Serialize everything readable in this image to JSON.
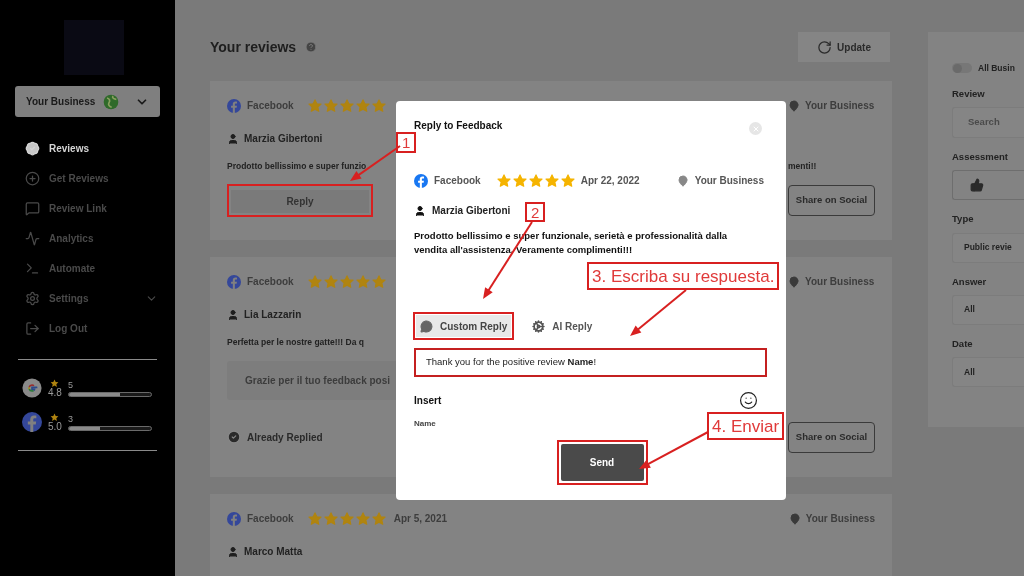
{
  "sidebar": {
    "business": "Your Business",
    "nav": [
      {
        "label": "Reviews",
        "selected": true,
        "has_submenu": false
      },
      {
        "label": "Get Reviews",
        "selected": false,
        "has_submenu": false
      },
      {
        "label": "Review Link",
        "selected": false,
        "has_submenu": false
      },
      {
        "label": "Analytics",
        "selected": false,
        "has_submenu": false
      },
      {
        "label": "Automate",
        "selected": false,
        "has_submenu": false
      },
      {
        "label": "Settings",
        "selected": false,
        "has_submenu": true
      },
      {
        "label": "Log Out",
        "selected": false,
        "has_submenu": false
      }
    ],
    "ratings": [
      {
        "kind": "google",
        "score": "4.8",
        "count": "5",
        "level": 0.62
      },
      {
        "kind": "facebook",
        "score": "5.0",
        "count": "3",
        "level": 0.38
      }
    ]
  },
  "header": {
    "title": "Your reviews",
    "update_button": "Update"
  },
  "reviews": [
    {
      "source": "Facebook",
      "stars": 5,
      "business": "Your Business",
      "author": "Marzia Gibertoni",
      "text_left": "Prodotto bellissimo e super funzio",
      "text_right": "menti!!",
      "kind": "pending",
      "action": "Reply",
      "share": "Share on Social"
    },
    {
      "source": "Facebook",
      "stars": 5,
      "business": "Your Business",
      "author": "Lia Lazzarin",
      "text_left": "Perfetta per le nostre gatte!!! Da q",
      "reply": "Grazie per il tuo feedback posi",
      "kind": "replied",
      "status": "Already Replied",
      "share": "Share on Social"
    },
    {
      "source": "Facebook",
      "stars": 5,
      "date": "Apr 5, 2021",
      "business": "Your Business",
      "author": "Marco Matta",
      "kind": "partial"
    }
  ],
  "filters": {
    "toggle": {
      "label": "All Busin",
      "on": false
    },
    "fields": [
      {
        "label": "Review",
        "kind": "search",
        "placeholder": "Search"
      },
      {
        "label": "Assessment",
        "kind": "thumbs"
      },
      {
        "label": "Type",
        "kind": "select",
        "value": "Public revie"
      },
      {
        "label": "Answer",
        "kind": "select",
        "value": "All"
      },
      {
        "label": "Date",
        "kind": "select",
        "value": "All"
      }
    ]
  },
  "modal": {
    "title": "Reply to Feedback",
    "source": "Facebook",
    "stars": 5,
    "date": "Apr 22, 2022",
    "business": "Your Business",
    "author": "Marzia Gibertoni",
    "text": "Prodotto bellissimo e super funzionale, serietà e professionalità dalla vendita all'assistenza. Veramente complimenti!!!",
    "tabs": [
      {
        "label": "Custom Reply",
        "selected": true
      },
      {
        "label": "AI Reply",
        "selected": false
      }
    ],
    "reply_value": "Thank you for the positive review **Name**!",
    "insert_label": "Insert",
    "insert_tags": [
      "Name"
    ],
    "send": "Send"
  },
  "annotations": [
    "1",
    "2",
    "3. Escriba su respuesta.",
    "4. Enviar"
  ]
}
